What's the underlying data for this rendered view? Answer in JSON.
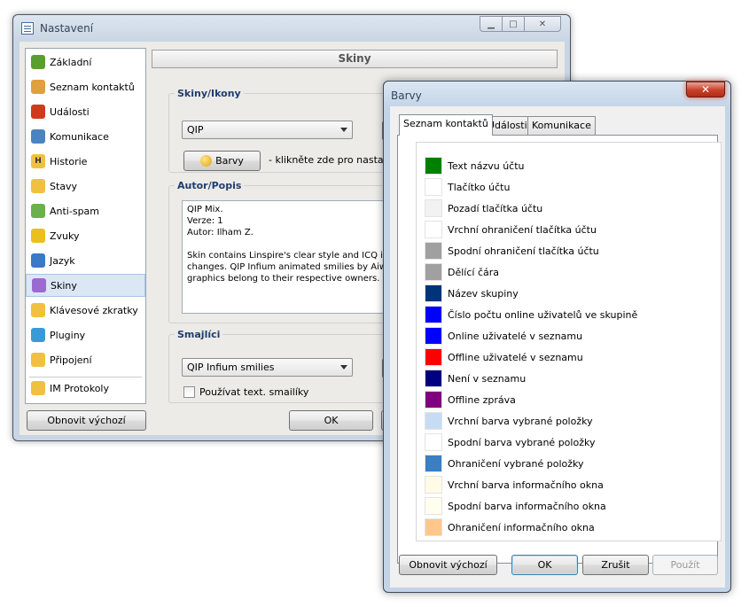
{
  "settings_window": {
    "title": "Nastavení",
    "sidebar": [
      {
        "label": "Základní",
        "icon": "basic-icon",
        "color": "#5a9e2f"
      },
      {
        "label": "Seznam kontaktů",
        "icon": "contacts-icon",
        "color": "#e0a040"
      },
      {
        "label": "Události",
        "icon": "events-icon",
        "color": "#d03a1c"
      },
      {
        "label": "Komunikace",
        "icon": "communication-icon",
        "color": "#4a84c0"
      },
      {
        "label": "Historie",
        "icon": "history-icon",
        "color": "#f0c040",
        "glyph": "H"
      },
      {
        "label": "Stavy",
        "icon": "status-icon",
        "color": "#f0c040"
      },
      {
        "label": "Anti-spam",
        "icon": "antispam-icon",
        "color": "#6ab04c"
      },
      {
        "label": "Zvuky",
        "icon": "sounds-icon",
        "color": "#e8c020"
      },
      {
        "label": "Jazyk",
        "icon": "language-icon",
        "color": "#3a78c8"
      },
      {
        "label": "Skiny",
        "icon": "skins-icon",
        "color": "#9a6ad0"
      },
      {
        "label": "Klávesové zkratky",
        "icon": "hotkeys-icon",
        "color": "#f0c040"
      },
      {
        "label": "Pluginy",
        "icon": "plugins-icon",
        "color": "#3a9ad8"
      },
      {
        "label": "Připojení",
        "icon": "connection-icon",
        "color": "#f0c040"
      },
      {
        "label": "IM Protokoly",
        "icon": "im-protocols-icon",
        "color": "#f0c040"
      }
    ],
    "selected_index": 9,
    "header": "Skiny",
    "skins_group": {
      "title": "Skiny/Ikony",
      "selected": "QIP",
      "colors_button": "Barvy",
      "colors_hint": "- klikněte zde pro nastavení"
    },
    "author_group": {
      "title": "Autor/Popis",
      "text": "QIP Mix.\nVerze: 1\nAutor: Ilham Z.\n\nSkin contains Linspire's clear style and ICQ icon\nchanges. QIP Infium animated smilies by Aiwar\ngraphics belong to their respective owners. Da"
    },
    "smileys_group": {
      "title": "Smajlíci",
      "selected": "QIP Infium smilies",
      "checkbox_label": "Používat text. smailíky",
      "checked": false
    },
    "buttons": {
      "reset": "Obnovit výchozí",
      "ok": "OK"
    }
  },
  "colors_window": {
    "title": "Barvy",
    "tabs": [
      "Seznam kontaktů",
      "Události",
      "Komunikace"
    ],
    "active_tab": 0,
    "colors": [
      {
        "label": "Text názvu účtu",
        "color": "#008000"
      },
      {
        "label": "Tlačítko účtu",
        "color": "#ffffff"
      },
      {
        "label": "Pozadí tlačítka účtu",
        "color": "#f2f2f2"
      },
      {
        "label": "Vrchní ohraničení tlačítka účtu",
        "color": "#ffffff"
      },
      {
        "label": "Spodní ohraničení tlačítka účtu",
        "color": "#a0a0a0"
      },
      {
        "label": "Dělící čára",
        "color": "#a0a0a0"
      },
      {
        "label": "Název skupiny",
        "color": "#003478"
      },
      {
        "label": "Číslo počtu online uživatelů ve skupině",
        "color": "#0000ff"
      },
      {
        "label": "Online uživatelé v seznamu",
        "color": "#0000ff"
      },
      {
        "label": "Offline uživatelé v seznamu",
        "color": "#ff0000"
      },
      {
        "label": "Není v seznamu",
        "color": "#000080"
      },
      {
        "label": "Offline zpráva",
        "color": "#800080"
      },
      {
        "label": "Vrchní barva vybrané položky",
        "color": "#c6dcf4"
      },
      {
        "label": "Spodní barva vybrané položky",
        "color": "#ffffff"
      },
      {
        "label": "Ohraničení vybrané položky",
        "color": "#3c7ec2"
      },
      {
        "label": "Vrchní barva informačního okna",
        "color": "#fffbe6"
      },
      {
        "label": "Spodní barva informačního okna",
        "color": "#fffff0"
      },
      {
        "label": "Ohraničení informačního okna",
        "color": "#ffc88a"
      }
    ],
    "buttons": {
      "reset": "Obnovit výchozí",
      "ok": "OK",
      "cancel": "Zrušit",
      "apply": "Použít"
    }
  }
}
